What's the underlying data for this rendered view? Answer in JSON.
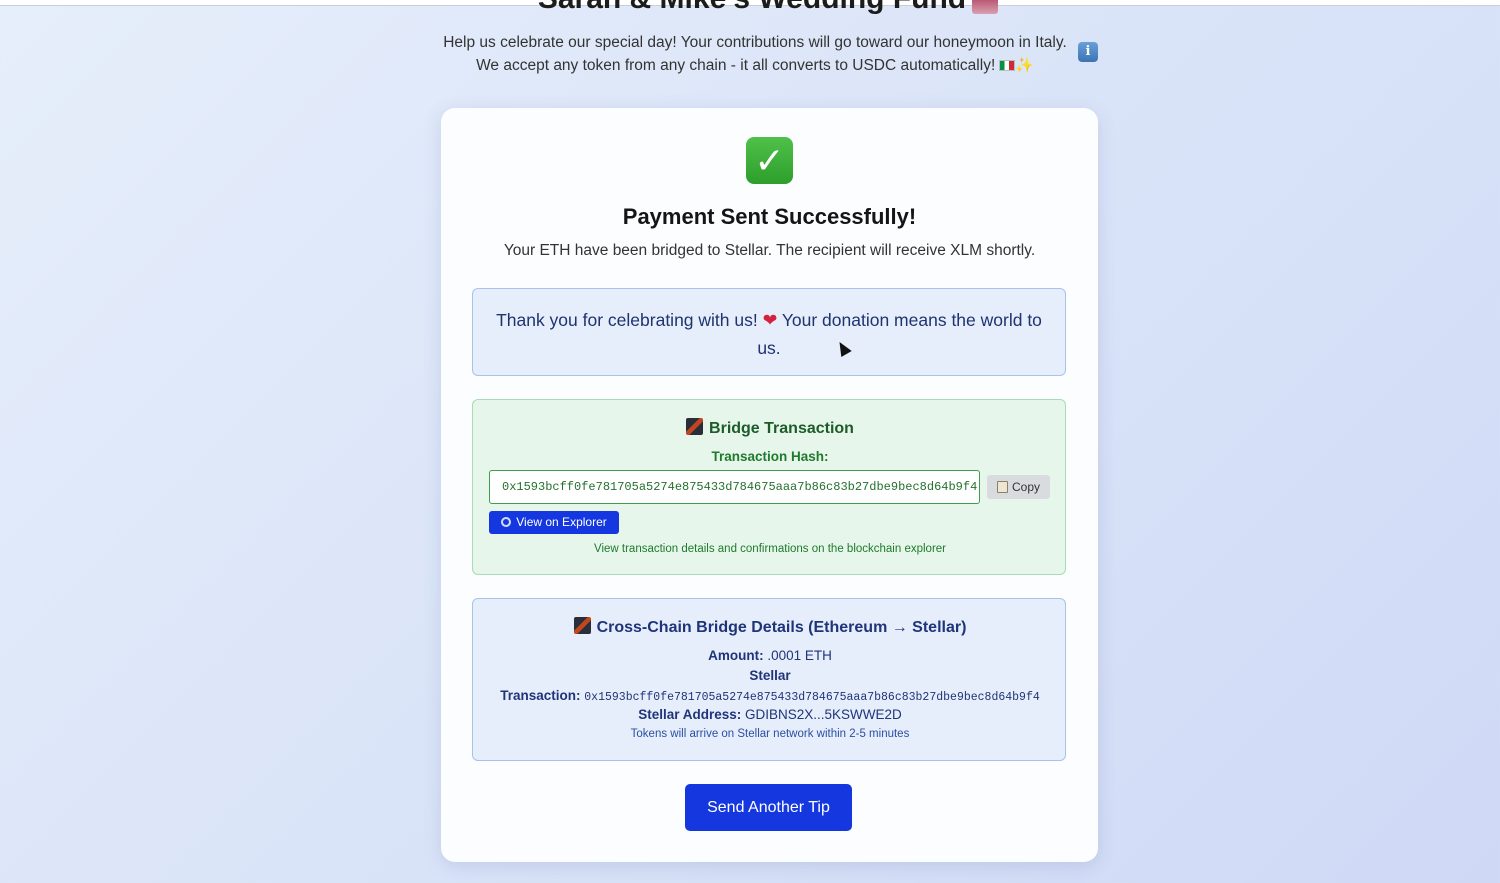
{
  "page": {
    "title": "Sarah & Mike's Wedding Fund",
    "subtitle_line1": "Help us celebrate our special day! Your contributions will go toward our honeymoon in Italy.",
    "subtitle_line2": "We accept any token from any chain - it all converts to USDC automatically!",
    "info_icon": "i"
  },
  "success": {
    "title": "Payment Sent Successfully!",
    "message": "Your ETH have been bridged to Stellar. The recipient will receive XLM shortly.",
    "thanks_before": "Thank you for celebrating with us!",
    "thanks_heart": "❤",
    "thanks_after": "Your donation means the world to us."
  },
  "bridge": {
    "heading": "Bridge Transaction",
    "hash_label": "Transaction Hash:",
    "hash_value": "0x1593bcff0fe781705a5274e875433d784675aaa7b86c83b27dbe9bec8d64b9f4",
    "copy_label": "Copy",
    "explorer_label": "View on Explorer",
    "explorer_note": "View transaction details and confirmations on the blockchain explorer"
  },
  "details": {
    "heading": "Cross-Chain Bridge Details (Ethereum → Stellar)",
    "amount_label": "Amount:",
    "amount_value": ".0001 ETH",
    "network": "Stellar",
    "tx_label": "Transaction:",
    "tx_value": "0x1593bcff0fe781705a5274e875433d784675aaa7b86c83b27dbe9bec8d64b9f4",
    "address_label": "Stellar Address:",
    "address_value": "GDIBNS2X...5KSWWE2D",
    "arrival_note": "Tokens will arrive on Stellar network within 2-5 minutes"
  },
  "actions": {
    "send_another": "Send Another Tip"
  },
  "colors": {
    "primary_button": "#1537e0",
    "success_green": "#2e9e2c",
    "bridge_bg": "#e6f6ea",
    "details_bg": "#e6eefb"
  }
}
